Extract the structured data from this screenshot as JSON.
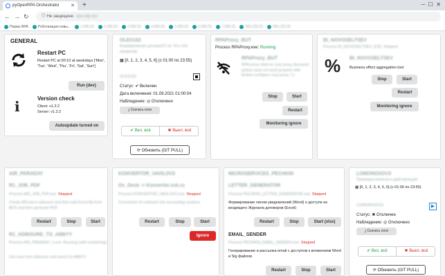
{
  "browser": {
    "tab_title": "pyOpenRPA Orchestrator",
    "url_warning": "Не защищено",
    "url_host": "rpa-vdp-55/",
    "bookmarks": [
      "Первы RPA",
      "Роботизация новы...",
      "1-996-55",
      "2-996-55",
      "3-996-55",
      "4-996-55",
      "5-996-55",
      "6-996-55",
      "7-996-55",
      "996-Z35-55",
      "996-Z35-55"
    ]
  },
  "general": {
    "title": "GENERAL",
    "restart_title": "Restart PC",
    "restart_desc": "Restart PC at 00:10 at weekdays ['Mon', 'Tue', 'Wed', 'Thu', 'Fri', 'Sat', 'Sun']",
    "run_dev": "Run (dev)",
    "version_title": "Version check",
    "client": "Client: v1.2.2",
    "server": "Server: v1.2.2",
    "autoupdate": "Autoupdate turned on"
  },
  "oles": {
    "title": "OLES162",
    "sub": "Формирование договорУС по 7й и 11й правилам",
    "schedule": "[0, 1, 2, 3, 4, 5, 6] (с 01:00 по 23:55)",
    "robot": "OLES162",
    "status_label": "Статус:",
    "status_val": "Включен",
    "date_label": "Дата включения:",
    "date_val": "01.09.2021 01:00:04",
    "monitor_label": "Наблюдение:",
    "monitor_val": "Отключено",
    "download": "Скачать логи",
    "on_all": "Вкл. всё",
    "off_all": "Выкл. всё",
    "update": "Обновить (GIT PULL)"
  },
  "rpaproxy": {
    "title": "RPAProxy_BUT",
    "process_prefix": "Process ",
    "process_name": "RPAProxy.exe",
    "process_mid": ": ",
    "process_state": "Running",
    "name": "RPAProxy_BUT",
    "desc": "RPA proxy shell on corp proxy (because python does not work properly with broken configure corp proxy :) )",
    "stop": "Stop",
    "start": "Start",
    "restart": "Restart",
    "monitoring": "Monitoring ignore"
  },
  "novo": {
    "title": "BI_NOVOSELTSEV",
    "sub": "Process BI_NOVOSELTSEV_EXE: Stopped",
    "name": "BI_NOVOSELTSEV",
    "desc": "Business effect aggregation tool",
    "stop": "Stop",
    "start": "Start",
    "restart": "Restart",
    "monitoring": "Monitoring ignore"
  },
  "air": {
    "title": "AIR_PARADAY",
    "r1": "R1_JOB_PDF",
    "r1_proc": "Process AIR_JOB_PDF.exe: ",
    "r1_state": "Stopped",
    "r1_desc": "Create AIR job in adinsure and then wait Excel file from BOS and then generate PDF",
    "restart": "Restart",
    "stop": "Stop",
    "start": "Start",
    "r2": "R1_ADINSURE_TO_ABBYY",
    "r2_proc": "Process AIR_PARADAY_1.exe: Running (with monitoring)",
    "r2_desc": "Get scan from Adinsure and send it to ABBYY"
  },
  "konv": {
    "title": "KONVERTOR_VAVILOV2",
    "name": "Oc_Desk -> Konvertor.vsk.ru",
    "proc": "Process KONVERTOR_VAVILOV2.exe: ",
    "state": "Stopped",
    "desc": "Conversion of contracts into accounting systems",
    "restart": "Restart",
    "stop": "Stop",
    "start": "Start",
    "ignore": "Ignore"
  },
  "micro": {
    "title": "MICROSERVICES_PECHKIN",
    "lg": "LETTER_GENERATOR",
    "lg_proc": "Process PECHKIN_LETTER_GENERATOR.exe: ",
    "lg_state": "Stopped",
    "lg_desc": "Формирование писем уведомлений (Word) о доступе из входящего Журнала договоров (Excel)",
    "restart": "Restart",
    "stop": "Stop",
    "start_xlsx": "Start (xlsx)",
    "es": "EMAIL_SENDER",
    "es_proc": "Process PECHKIN_EMAIL_SENDER.exe: ",
    "es_state": "Stopped",
    "es_desc": "Генерирование и рассылка email с доступом к вложениям Word и Sig файлов",
    "start": "Start"
  },
  "lomo": {
    "title": "LOMONOSOV3",
    "sub": "Проверка полисов в действующей",
    "schedule": "[0, 1, 2, 3, 4, 5, 6] (с 01:00 по 23:55)",
    "robot": "LOMONOSOV3",
    "status_label": "Статус:",
    "status_val": "Отключен",
    "monitor_label": "Наблюдение:",
    "monitor_val": "Отключено",
    "download": "Скачать логи",
    "on_all": "Вкл. всё",
    "off_all": "Выкл. всё",
    "update": "Обновить (GIT PULL)"
  }
}
